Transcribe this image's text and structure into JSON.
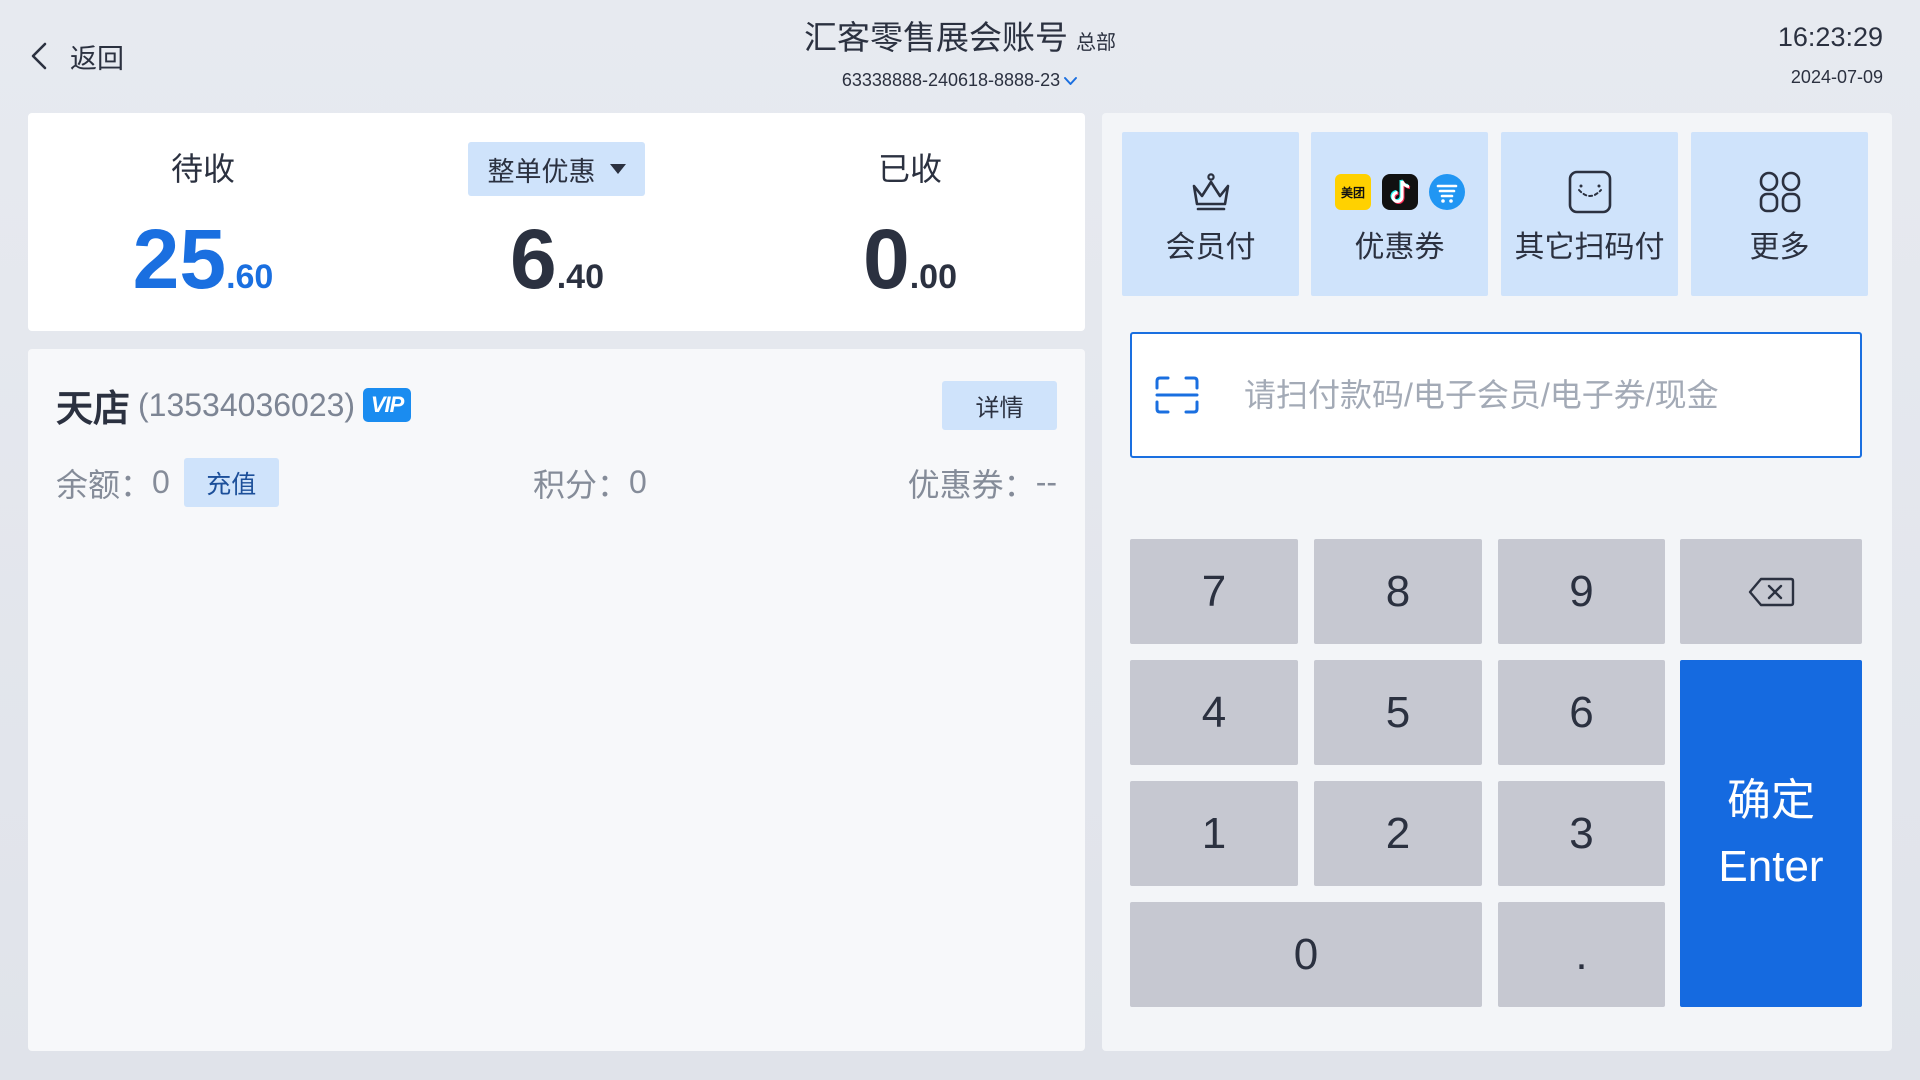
{
  "header": {
    "back_label": "返回",
    "title": "汇客零售展会账号",
    "title_tag": "总部",
    "account_no": "63338888-240618-8888-23",
    "time": "16:23:29",
    "date": "2024-07-09"
  },
  "summary": {
    "pending": {
      "label": "待收",
      "int": "25",
      "dec": ".60"
    },
    "discount": {
      "button_label": "整单优惠",
      "int": "6",
      "dec": ".40"
    },
    "received": {
      "label": "已收",
      "int": "0",
      "dec": ".00"
    }
  },
  "member": {
    "name": "天店",
    "phone": "(13534036023)",
    "vip_badge": "VIP",
    "details_label": "详情",
    "balance_label": "余额：",
    "balance_value": "0",
    "recharge_label": "充值",
    "points_label": "积分：",
    "points_value": "0",
    "coupons_label": "优惠券：",
    "coupons_value": "--"
  },
  "payment_methods": [
    {
      "label": "会员付",
      "icon": "crown-icon"
    },
    {
      "label": "优惠券",
      "icon": "coupon-platform-icons",
      "meituan_text": "美团"
    },
    {
      "label": "其它扫码付",
      "icon": "scan-pay-icon"
    },
    {
      "label": "更多",
      "icon": "grid-icon"
    }
  ],
  "scan_input": {
    "placeholder": "请扫付款码/电子会员/电子券/现金",
    "value": ""
  },
  "keypad": {
    "keys": [
      "7",
      "8",
      "9",
      "4",
      "5",
      "6",
      "1",
      "2",
      "3",
      "0",
      "."
    ],
    "backspace_icon": "backspace-icon",
    "enter_label_cn": "确定",
    "enter_label_en": "Enter"
  },
  "colors": {
    "accent": "#1a6fe0",
    "tile_bg": "#cfe3fb",
    "key_bg": "#c6c8d1",
    "enter_bg": "#156ae0",
    "text_dark": "#2b3140",
    "text_muted": "#858c99",
    "page_bg": "#e4e7ed"
  }
}
